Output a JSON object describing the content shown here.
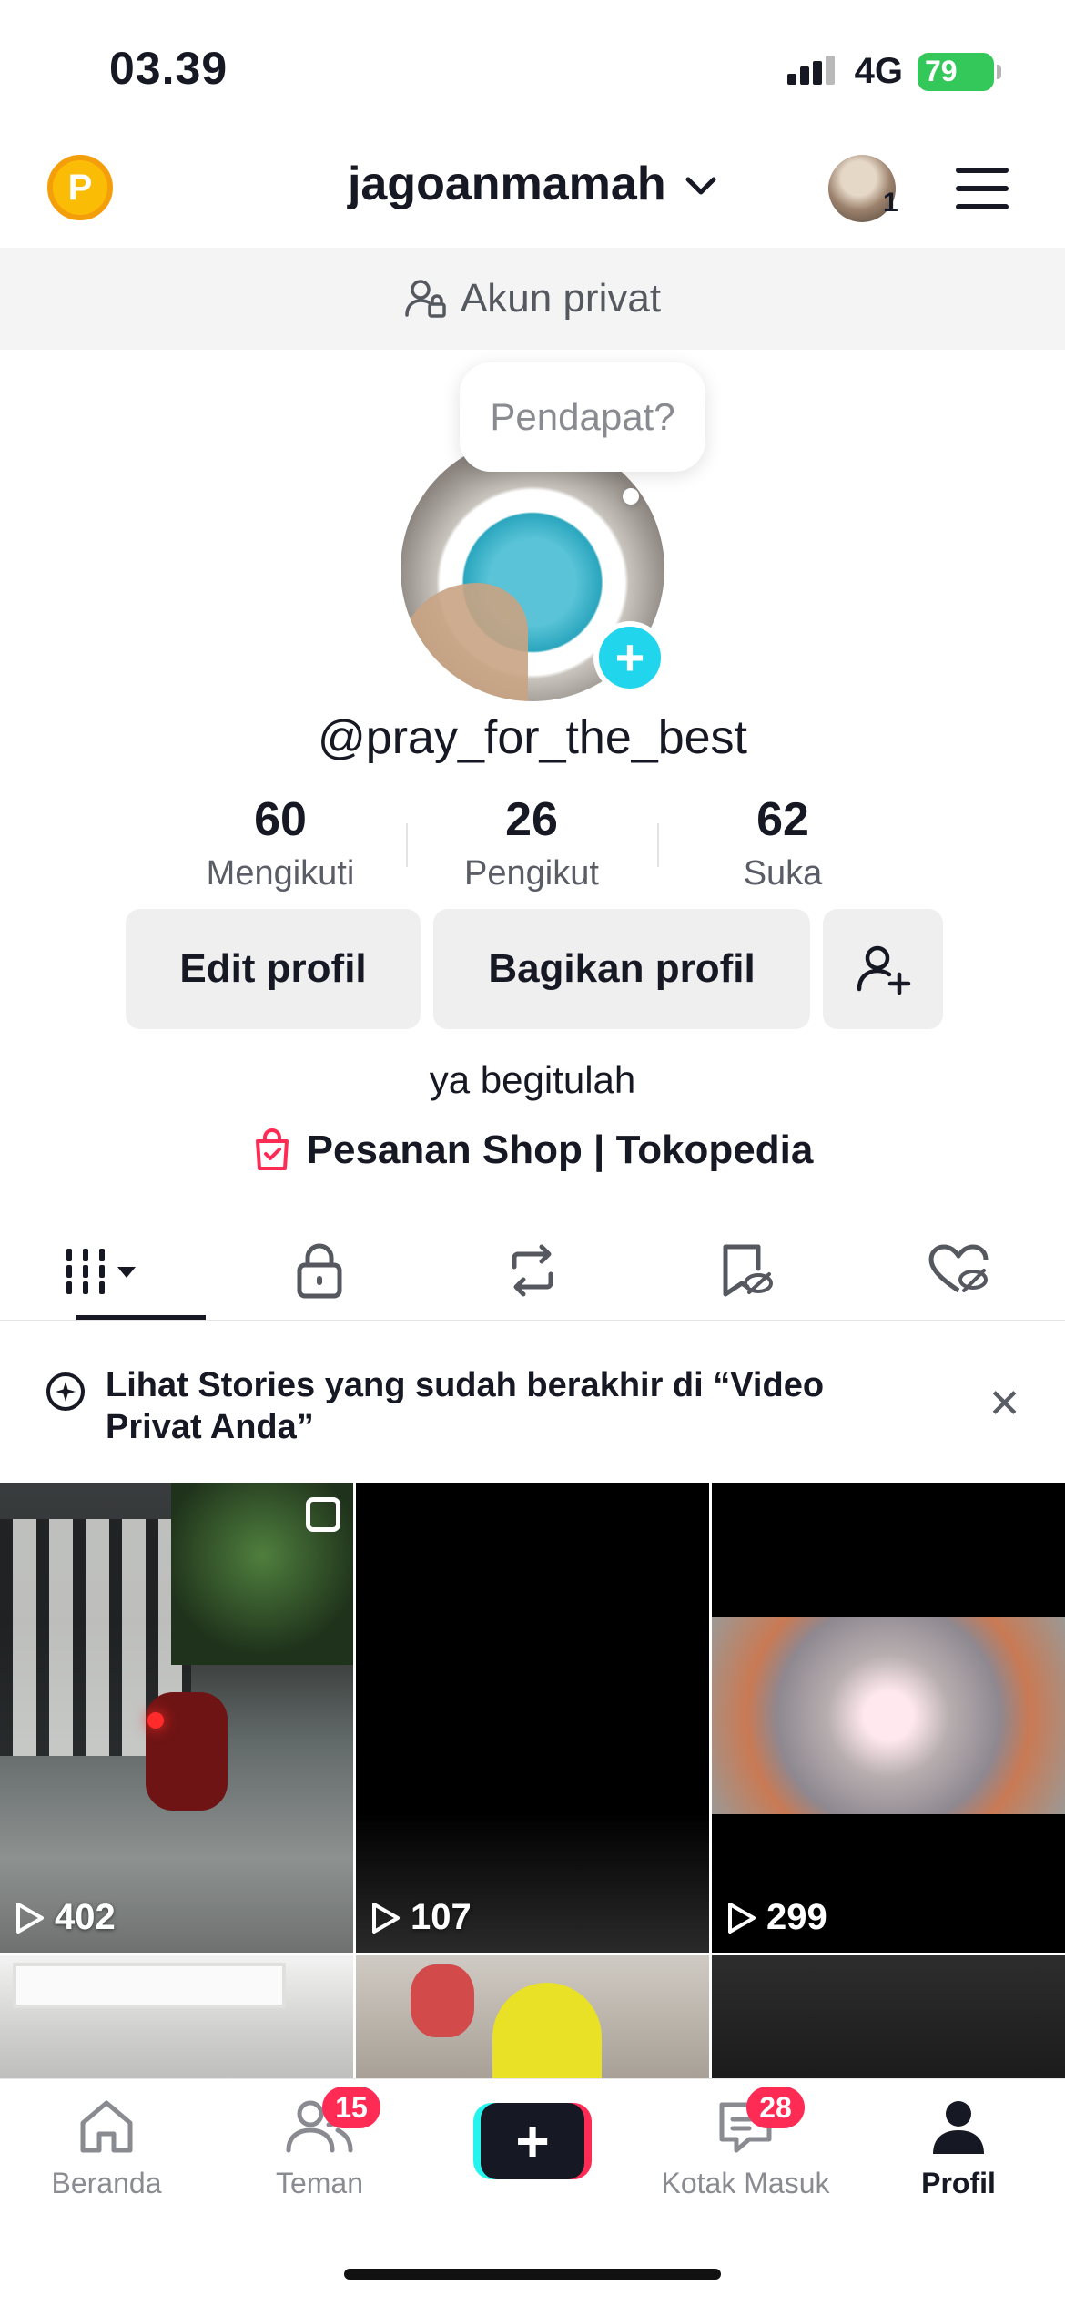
{
  "status_bar": {
    "time": "03.39",
    "network": "4G",
    "battery": "79"
  },
  "header": {
    "username": "jagoanmamah",
    "account_switch_count": "1",
    "coin_label": "P"
  },
  "private_banner": {
    "text": "Akun privat"
  },
  "profile": {
    "note_bubble": "Pendapat?",
    "handle": "@pray_for_the_best",
    "stats": [
      {
        "value": "60",
        "label": "Mengikuti"
      },
      {
        "value": "26",
        "label": "Pengikut"
      },
      {
        "value": "62",
        "label": "Suka"
      }
    ],
    "buttons": {
      "edit": "Edit profil",
      "share": "Bagikan profil"
    },
    "bio": "ya begitulah",
    "shop_link": "Pesanan Shop | Tokopedia"
  },
  "tabs": [
    {
      "icon": "grid-icon",
      "active": true
    },
    {
      "icon": "lock-icon",
      "active": false
    },
    {
      "icon": "repost-icon",
      "active": false
    },
    {
      "icon": "favorites-hidden-icon",
      "active": false
    },
    {
      "icon": "liked-hidden-icon",
      "active": false
    }
  ],
  "stories_notice": {
    "text": "Lihat Stories yang sudah berakhir di “Video Privat Anda”"
  },
  "videos": [
    {
      "views": "402",
      "multi": true
    },
    {
      "views": "107"
    },
    {
      "views": "299"
    },
    {
      "views": ""
    },
    {
      "views": ""
    },
    {
      "views": ""
    }
  ],
  "bottom_nav": {
    "items": [
      {
        "label": "Beranda",
        "icon": "home-icon"
      },
      {
        "label": "Teman",
        "icon": "friends-icon",
        "badge": "15"
      },
      {
        "label": "",
        "icon": "create-icon"
      },
      {
        "label": "Kotak Masuk",
        "icon": "inbox-icon",
        "badge": "28"
      },
      {
        "label": "Profil",
        "icon": "profile-icon",
        "active": true
      }
    ]
  },
  "colors": {
    "accent_pink": "#fe2c55",
    "accent_cyan": "#25f4ee",
    "battery_green": "#34c759"
  }
}
